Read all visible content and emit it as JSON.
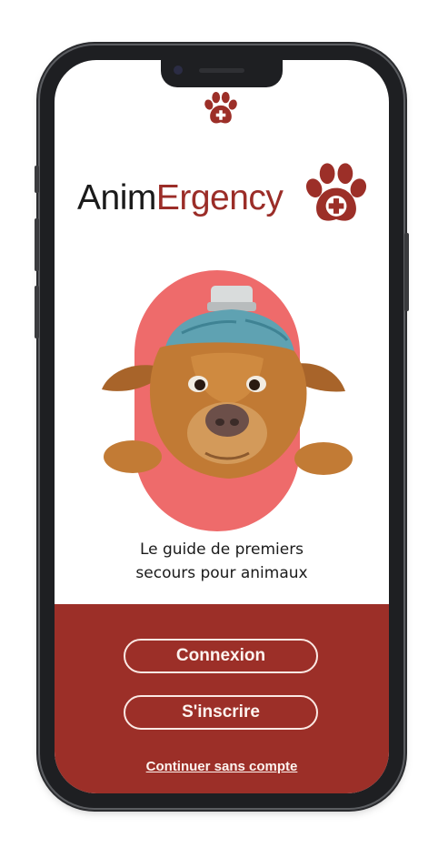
{
  "app": {
    "name_part1": "Anim",
    "name_part2": "Ergency",
    "tagline_line1": "Le guide de premiers",
    "tagline_line2": "secours pour animaux"
  },
  "actions": {
    "login_label": "Connexion",
    "signup_label": "S'inscrire",
    "guest_label": "Continuer sans compte"
  },
  "theme": {
    "brand_red": "#9c2f28",
    "accent_pink": "#ee6b6b",
    "text_dark": "#1a1a1a"
  },
  "icons": {
    "top_logo": "paw-plus-icon",
    "brand_logo": "paw-plus-icon"
  }
}
